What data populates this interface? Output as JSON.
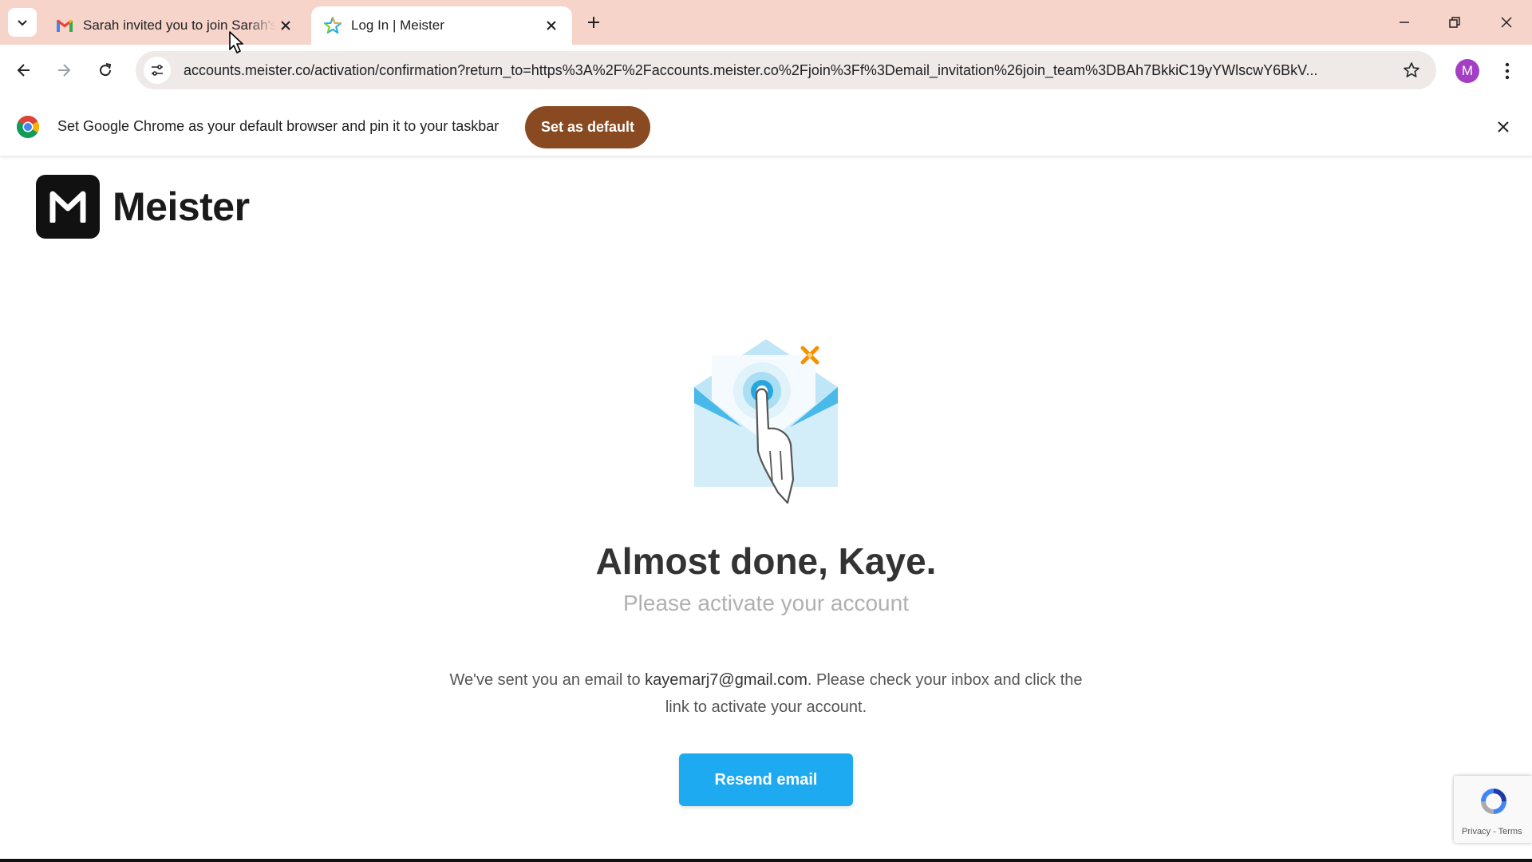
{
  "browser": {
    "tabs": [
      {
        "title": "Sarah invited you to join Sarah's",
        "favicon": "gmail-icon",
        "active": false
      },
      {
        "title": "Log In | Meister",
        "favicon": "meister-star-icon",
        "active": true
      }
    ],
    "address_bar": {
      "url": "accounts.meister.co/activation/confirmation?return_to=https%3A%2F%2Faccounts.meister.co%2Fjoin%3Ff%3Demail_invitation%26join_team%3DBAh7BkkiC19yYWlscwY6BkV..."
    },
    "profile_initial": "M",
    "infobar": {
      "message": "Set Google Chrome as your default browser and pin it to your taskbar",
      "button_label": "Set as default"
    }
  },
  "page": {
    "logo_text": "Meister",
    "headline": "Almost done, Kaye.",
    "subheadline": "Please activate your account",
    "message_before": "We've sent you an email to ",
    "email": "kayemarj7@gmail.com",
    "message_after": ". Please check your inbox and click the link to activate your account.",
    "resend_button": "Resend email",
    "recaptcha": {
      "privacy": "Privacy",
      "separator": " - ",
      "terms": "Terms"
    }
  },
  "colors": {
    "tabstrip_bg": "#f7d4c9",
    "set_default_button": "#8a4a21",
    "resend_button": "#1eaaf1",
    "avatar_bg": "#a23fc4"
  }
}
